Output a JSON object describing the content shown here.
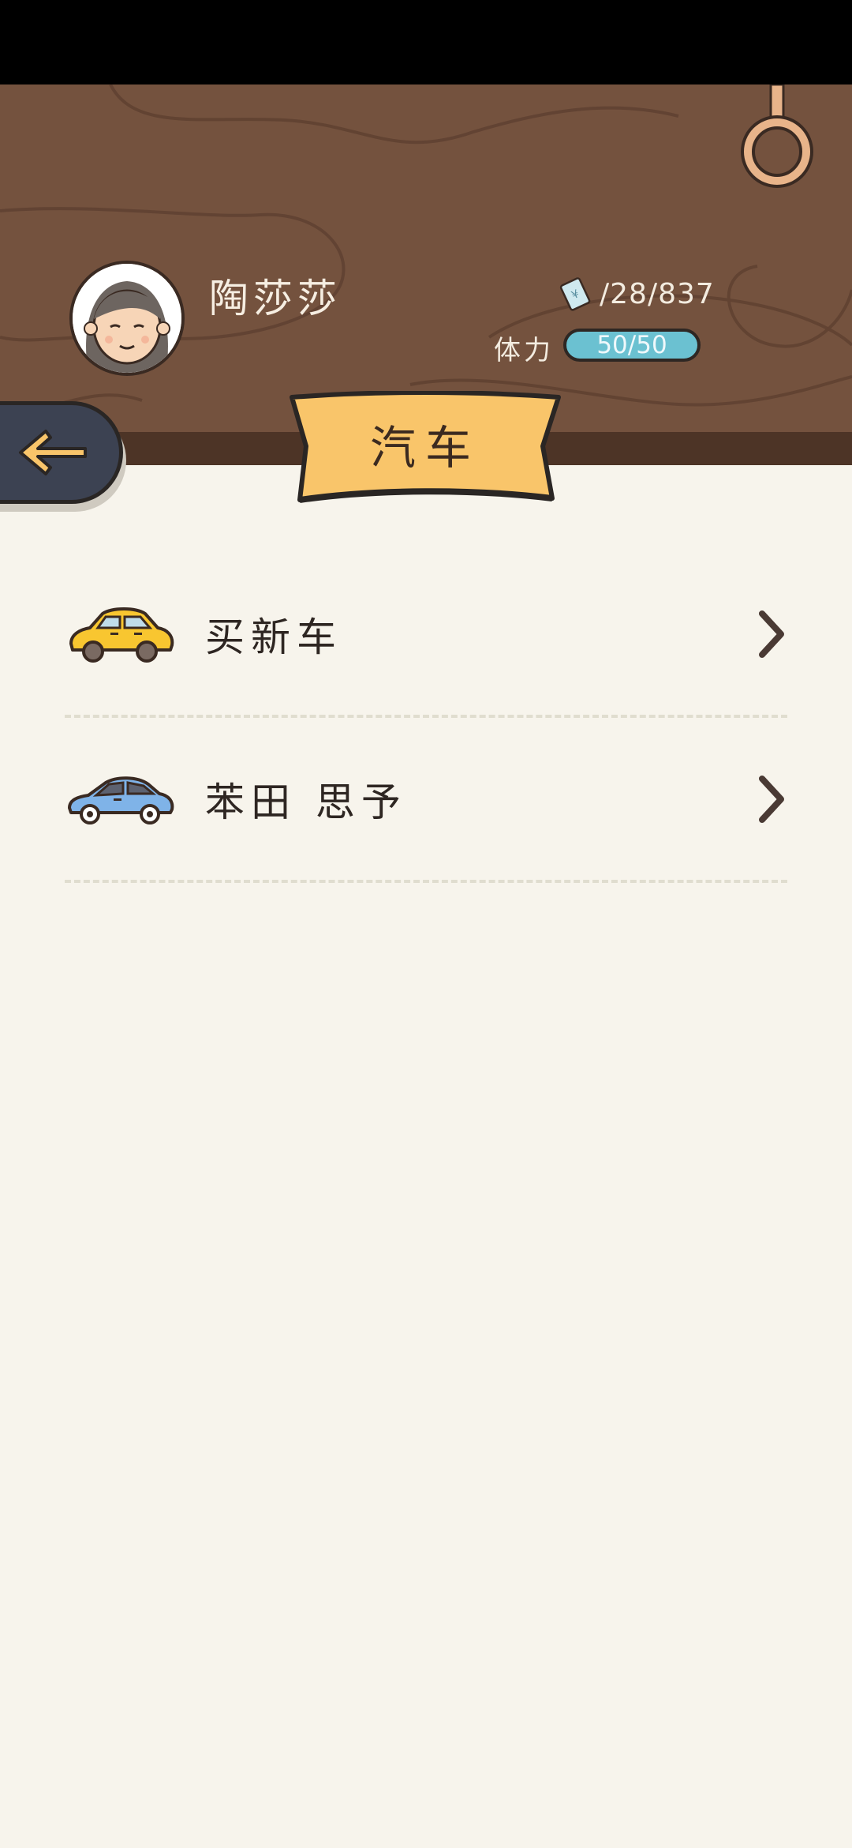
{
  "player": {
    "name": "陶莎莎",
    "money": "/28/837",
    "stamina_label": "体力",
    "stamina_text": "50/50",
    "stamina_fraction": 1.0
  },
  "page": {
    "title": "汽车"
  },
  "items": [
    {
      "label": "买新车",
      "icon": "yellow-car-icon"
    },
    {
      "label": "苯田 思予",
      "icon": "blue-car-icon"
    }
  ],
  "colors": {
    "wood": "#74523e",
    "banner": "#f9c56a",
    "stamina": "#6bc1d1",
    "back_button": "#3c4252",
    "background": "#f7f4ec"
  }
}
